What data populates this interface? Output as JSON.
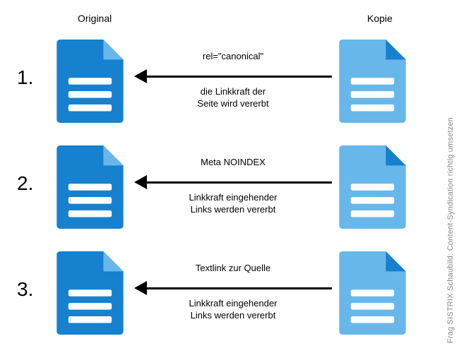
{
  "headers": {
    "original": "Original",
    "kopie": "Kopie"
  },
  "colors": {
    "original_doc": "#1581cf",
    "original_fold": "#68b7ea",
    "kopie_doc": "#68b7ea",
    "kopie_fold": "#1581cf",
    "arrow": "#000000"
  },
  "rows": [
    {
      "num": "1.",
      "top_label": "rel=\"canonical\"",
      "bottom_label": "die Linkkraft der\nSeite wird vererbt"
    },
    {
      "num": "2.",
      "top_label": "Meta NOINDEX",
      "bottom_label": "Linkkraft eingehender\nLinks werden vererbt"
    },
    {
      "num": "3.",
      "top_label": "Textlink zur Quelle",
      "bottom_label": "Linkkraft eingehender\nLinks werden vererbt"
    }
  ],
  "sidetext": "Frag SISTRIX Schaubild: Content-Syndication richtig umsetzen"
}
